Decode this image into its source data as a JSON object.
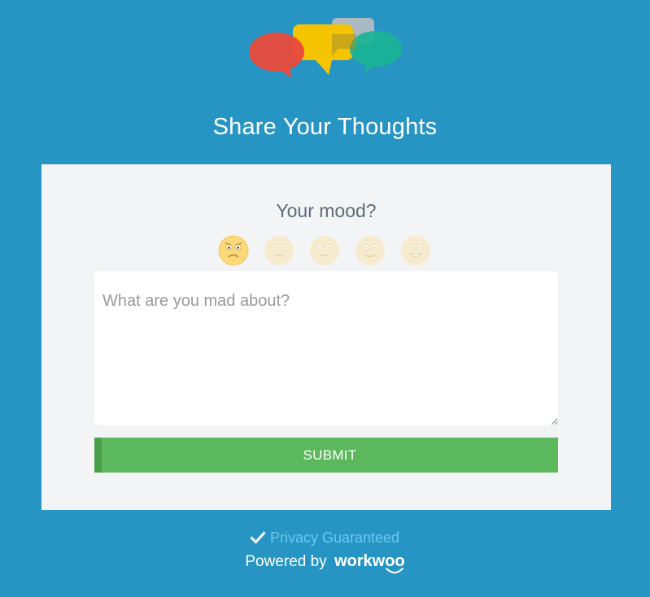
{
  "header": {
    "title": "Share Your Thoughts",
    "logo_icon": "speech-bubbles-icon"
  },
  "form": {
    "mood_label": "Your mood?",
    "moods": [
      {
        "name": "mad",
        "icon": "mad-face-icon",
        "selected": true
      },
      {
        "name": "sad",
        "icon": "sad-face-icon",
        "selected": false
      },
      {
        "name": "neutral",
        "icon": "neutral-face-icon",
        "selected": false
      },
      {
        "name": "happy",
        "icon": "happy-face-icon",
        "selected": false
      },
      {
        "name": "excited",
        "icon": "excited-face-icon",
        "selected": false
      }
    ],
    "feedback_value": "",
    "feedback_placeholder": "What are you mad about?",
    "submit_label": "SUBMIT"
  },
  "footer": {
    "privacy_text": "Privacy Guaranteed",
    "powered_by": "Powered by",
    "brand": "workwoo"
  },
  "colors": {
    "background": "#2795c4",
    "card": "#f3f4f6",
    "submit": "#5cb85c",
    "privacy_link": "#6cc8f0",
    "mood_active": "#fbd97b",
    "mood_inactive": "#f6ebcf"
  }
}
